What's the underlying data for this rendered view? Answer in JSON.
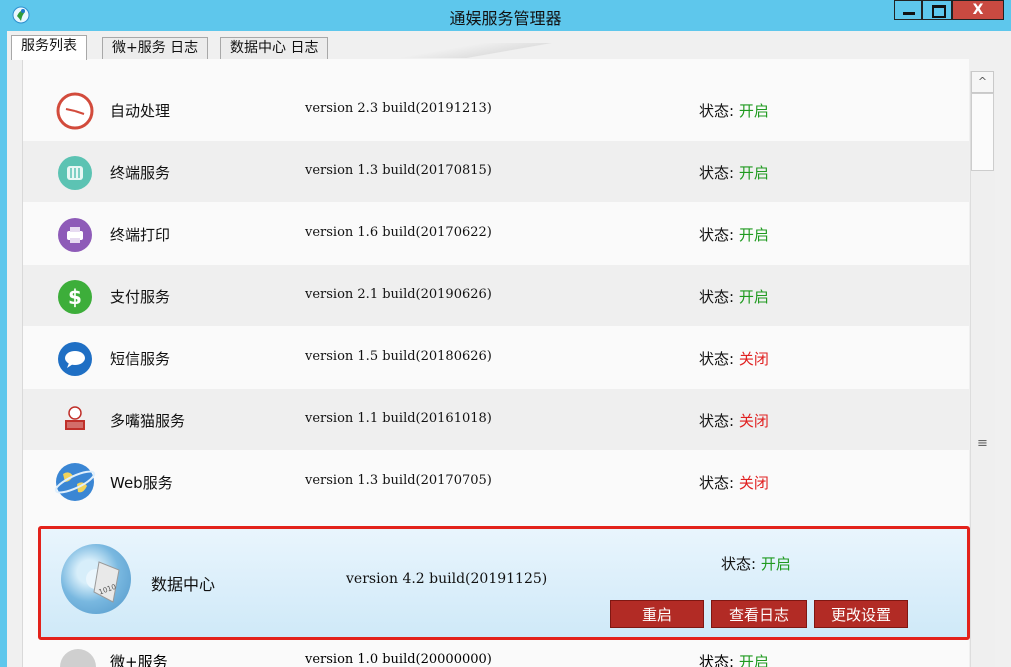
{
  "window": {
    "title": "通娱服务管理器",
    "close_label": "X"
  },
  "tabs": [
    {
      "label": "服务列表",
      "active": true
    },
    {
      "label": "微+服务 日志",
      "active": false
    },
    {
      "label": "数据中心 日志",
      "active": false
    }
  ],
  "status_prefix": "状态:",
  "services": [
    {
      "name": "自动处理",
      "version": "version 2.3 build(20191213)",
      "status": "开启",
      "icon": "clock-icon"
    },
    {
      "name": "终端服务",
      "version": "version 1.3 build(20170815)",
      "status": "开启",
      "icon": "terminal-service-icon"
    },
    {
      "name": "终端打印",
      "version": "version 1.6 build(20170622)",
      "status": "开启",
      "icon": "printer-icon"
    },
    {
      "name": "支付服务",
      "version": "version 2.1 build(20190626)",
      "status": "开启",
      "icon": "dollar-icon"
    },
    {
      "name": "短信服务",
      "version": "version 1.5 build(20180626)",
      "status": "关闭",
      "icon": "sms-icon"
    },
    {
      "name": "多嘴猫服务",
      "version": "version 1.1 build(20161018)",
      "status": "关闭",
      "icon": "cat-logo-icon"
    },
    {
      "name": "Web服务",
      "version": "version 1.3 build(20170705)",
      "status": "关闭",
      "icon": "globe-icon"
    }
  ],
  "selected_service": {
    "name": "数据中心",
    "version": "version 4.2 build(20191125)",
    "status": "开启",
    "icon": "disk-icon",
    "disk_label": "1010",
    "buttons": {
      "restart": "重启",
      "view_log": "查看日志",
      "settings": "更改设置"
    }
  },
  "partial_row": {
    "name": "微+服务",
    "version": "version 1.0 build(20000000)",
    "status": "开启"
  },
  "colors": {
    "status_on": "#1f9a1f",
    "status_off": "#e02020",
    "accent": "#b22b25",
    "selection_border": "#e3221b"
  }
}
